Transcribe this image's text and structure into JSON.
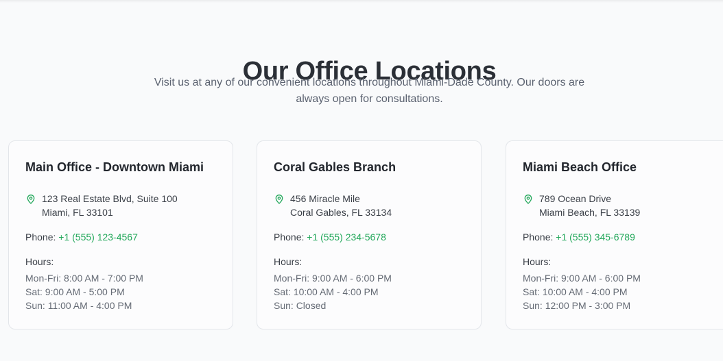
{
  "section": {
    "title": "Our Office Locations",
    "subtitle": "Visit us at any of our convenient locations throughout Miami-Dade County. Our doors are always open for consultations."
  },
  "colors": {
    "accent": "#22a75a",
    "title": "#2b2f36",
    "muted": "#656b75"
  },
  "labels": {
    "phone": "Phone:",
    "hours": "Hours:"
  },
  "offices": [
    {
      "name": "Main Office - Downtown Miami",
      "address_line1": "123 Real Estate Blvd, Suite 100",
      "address_line2": "Miami, FL 33101",
      "phone": "+1 (555) 123-4567",
      "hours": [
        "Mon-Fri: 8:00 AM - 7:00 PM",
        "Sat: 9:00 AM - 5:00 PM",
        "Sun: 11:00 AM - 4:00 PM"
      ],
      "icon": "map-pin-icon"
    },
    {
      "name": "Coral Gables Branch",
      "address_line1": "456 Miracle Mile",
      "address_line2": "Coral Gables, FL 33134",
      "phone": "+1 (555) 234-5678",
      "hours": [
        "Mon-Fri: 9:00 AM - 6:00 PM",
        "Sat: 10:00 AM - 4:00 PM",
        "Sun: Closed"
      ],
      "icon": "map-pin-icon"
    },
    {
      "name": "Miami Beach Office",
      "address_line1": "789 Ocean Drive",
      "address_line2": "Miami Beach, FL 33139",
      "phone": "+1 (555) 345-6789",
      "hours": [
        "Mon-Fri: 9:00 AM - 6:00 PM",
        "Sat: 10:00 AM - 4:00 PM",
        "Sun: 12:00 PM - 3:00 PM"
      ],
      "icon": "map-pin-icon"
    }
  ]
}
